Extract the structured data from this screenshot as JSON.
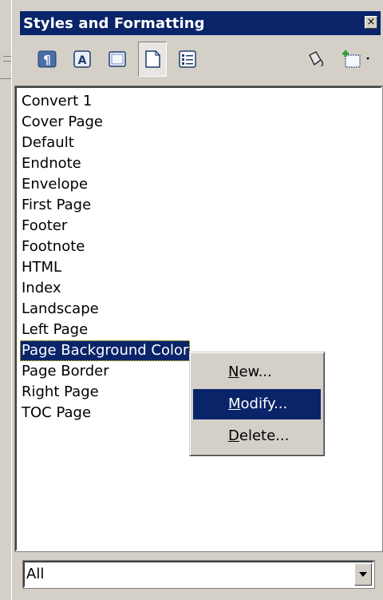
{
  "window": {
    "title": "Styles and Formatting",
    "close_symbol": "×"
  },
  "toolbar": {
    "buttons": [
      {
        "icon": "paragraph-styles-icon",
        "active": false
      },
      {
        "icon": "character-styles-icon",
        "active": false
      },
      {
        "icon": "frame-styles-icon",
        "active": false
      },
      {
        "icon": "page-styles-icon",
        "active": true
      },
      {
        "icon": "list-styles-icon",
        "active": false
      },
      {
        "icon": "fill-format-mode-icon",
        "active": false
      },
      {
        "icon": "new-style-from-selection-icon",
        "active": false
      }
    ]
  },
  "styles_list": {
    "items": [
      "Convert 1",
      "Cover Page",
      "Default",
      "Endnote",
      "Envelope",
      "First Page",
      "Footer",
      "Footnote",
      "HTML",
      "Index",
      "Landscape",
      "Left Page",
      "Page Background Color",
      "Page Border",
      "Right Page",
      "TOC Page"
    ],
    "selected": "Page Background Color"
  },
  "context_menu": {
    "items": [
      {
        "mnemonic": "N",
        "rest": "ew..."
      },
      {
        "mnemonic": "M",
        "rest": "odify..."
      },
      {
        "mnemonic": "D",
        "rest": "elete..."
      }
    ],
    "highlighted": "Modify..."
  },
  "filter": {
    "value": "All"
  },
  "colors": {
    "title_bar": "#0a246a",
    "face": "#d4d0c8",
    "selection": "#0a246a"
  }
}
